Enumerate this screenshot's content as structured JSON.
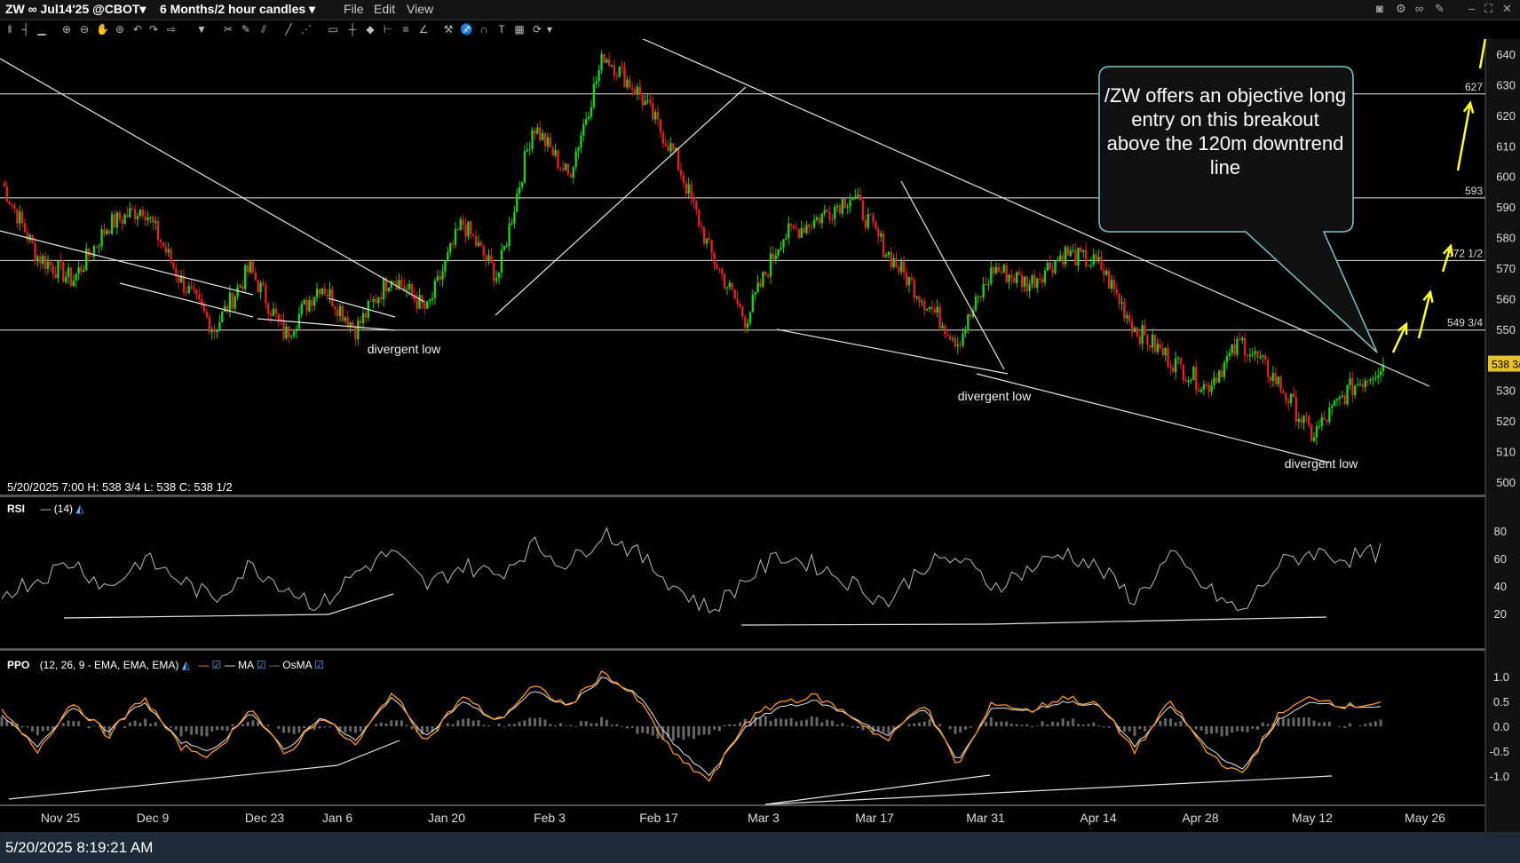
{
  "header": {
    "symbol": "ZW ∞ Jul14'25 @CBOT▾",
    "timeframe": "6 Months/2 hour candles ▾",
    "menu": [
      "File",
      "Edit",
      "View"
    ]
  },
  "status_text": "5/20/2025 7:00   H: 538 3/4   L: 538   C: 538 1/2",
  "callout": "/ZW offers an objective long entry on this breakout above the 120m downtrend line",
  "footer_timestamp": "5/20/2025 8:19:21 AM",
  "rsi_label": {
    "name": "RSI",
    "params": "(14)"
  },
  "ppo_label": {
    "name": "PPO",
    "params": "(12, 26, 9 - EMA, EMA, EMA)",
    "ma": "MA",
    "osma": "OsMA"
  },
  "colors": {
    "up": "#22cc22",
    "down": "#dd2222",
    "lines": "#e6e6e6",
    "arrows": "#ffff33",
    "ppo": "#ff9922",
    "ma": "#e6e6e6",
    "callout_border": "#7fc8c8",
    "callout_bg": "#111111"
  },
  "chart_data": [
    {
      "type": "candlestick",
      "title": "",
      "y_axis": {
        "range": [
          500,
          640
        ],
        "ticks": [
          500,
          510,
          520,
          530,
          540,
          550,
          560,
          570,
          580,
          590,
          600,
          610,
          620,
          630,
          640
        ]
      },
      "x_axis": {
        "ticks": [
          "Nov 25",
          "Dec 9",
          "Dec 23",
          "Jan 6",
          "Jan 20",
          "Feb 3",
          "Feb 17",
          "Mar 3",
          "Mar 17",
          "Mar 31",
          "Apr 14",
          "Apr 28",
          "May 12",
          "May 26"
        ]
      },
      "price_anchors": {
        "categories": [
          "Nov 18",
          "Nov 22",
          "Nov 29",
          "Dec 4",
          "Dec 12",
          "Dec 20",
          "Dec 26",
          "Jan 2",
          "Jan 7",
          "Jan 10",
          "Jan 14",
          "Jan 20",
          "Jan 24",
          "Jan 28",
          "Feb 3",
          "Feb 7",
          "Feb 12",
          "Feb 17",
          "Feb 18",
          "Feb 24",
          "Feb 28",
          "Mar 4",
          "Mar 7",
          "Mar 14",
          "Mar 17",
          "Mar 21",
          "Mar 27",
          "Mar 31",
          "Apr 3",
          "Apr 9",
          "Apr 14",
          "Apr 18",
          "Apr 23",
          "Apr 28",
          "May 2",
          "May 5",
          "May 8",
          "May 13",
          "May 16",
          "May 20"
        ],
        "values": [
          598,
          574,
          566,
          584,
          590,
          567,
          550,
          570,
          548,
          565,
          550,
          568,
          556,
          585,
          567,
          617,
          600,
          640,
          627,
          607,
          575,
          553,
          580,
          586,
          594,
          575,
          560,
          546,
          570,
          565,
          575,
          571,
          550,
          540,
          531,
          546,
          533,
          515,
          530,
          538.5
        ]
      },
      "horizontal_levels": [
        {
          "value": 627,
          "label": "627"
        },
        {
          "value": 593,
          "label": "593"
        },
        {
          "value": 572.5,
          "label": "572 1/2"
        },
        {
          "value": 549.75,
          "label": "549 3/4"
        }
      ],
      "current_price_label": "538 3/4",
      "annotations": [
        "divergent low",
        "divergent low",
        "divergent low"
      ]
    },
    {
      "type": "line",
      "title": "RSI (14)",
      "y_axis": {
        "ticks": [
          20,
          40,
          60,
          80
        ]
      },
      "series": [
        {
          "name": "RSI",
          "values": [
            35,
            45,
            58,
            38,
            60,
            45,
            30,
            55,
            40,
            25,
            50,
            65,
            40,
            55,
            48,
            70,
            55,
            80,
            62,
            40,
            22,
            45,
            62,
            55,
            42,
            28,
            55,
            60,
            40,
            52,
            65,
            52,
            30,
            62,
            38,
            20,
            55,
            65,
            60,
            65
          ]
        }
      ]
    },
    {
      "type": "line",
      "title": "PPO (12, 26, 9 - EMA, EMA, EMA)",
      "y_axis": {
        "ticks": [
          -1.0,
          -0.5,
          0.0,
          0.5,
          1.0
        ]
      },
      "series": [
        {
          "name": "PPO",
          "values": [
            0.3,
            -0.5,
            0.5,
            -0.2,
            0.6,
            -0.4,
            -0.6,
            0.4,
            -0.6,
            0.2,
            -0.4,
            0.7,
            -0.3,
            0.6,
            0.1,
            0.8,
            0.4,
            1.1,
            0.5,
            -0.6,
            -1.1,
            0.1,
            0.5,
            0.6,
            0.2,
            -0.3,
            0.5,
            -0.8,
            0.5,
            0.3,
            0.6,
            0.4,
            -0.5,
            0.5,
            -0.5,
            -1.0,
            0.2,
            0.6,
            0.4,
            0.5
          ]
        },
        {
          "name": "MA",
          "values": [
            0.2,
            -0.4,
            0.4,
            -0.1,
            0.5,
            -0.3,
            -0.5,
            0.3,
            -0.5,
            0.2,
            -0.3,
            0.6,
            -0.2,
            0.5,
            0.1,
            0.7,
            0.4,
            1.0,
            0.6,
            -0.4,
            -1.0,
            0.0,
            0.4,
            0.5,
            0.2,
            -0.2,
            0.4,
            -0.7,
            0.4,
            0.3,
            0.5,
            0.4,
            -0.4,
            0.4,
            -0.4,
            -0.9,
            0.1,
            0.5,
            0.4,
            0.4
          ]
        }
      ]
    }
  ]
}
